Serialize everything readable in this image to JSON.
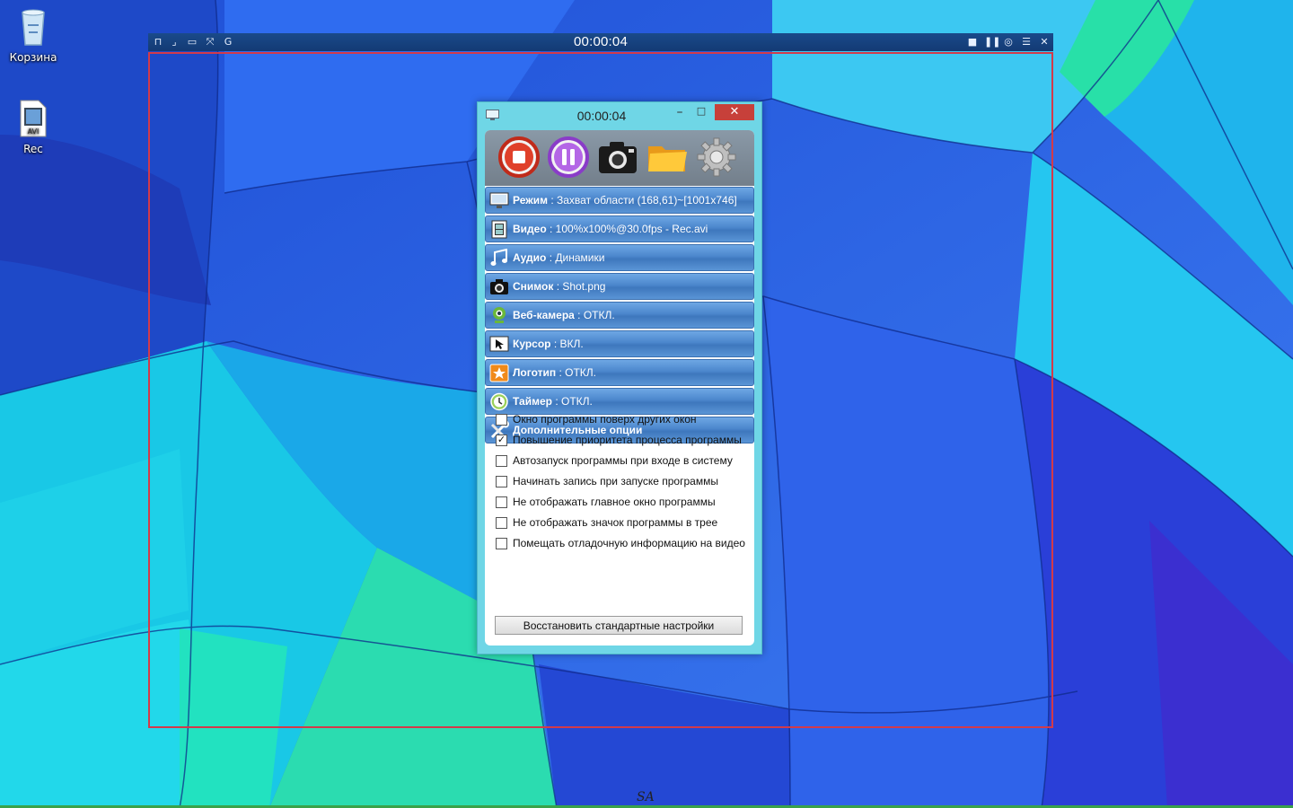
{
  "desktop": {
    "icons": [
      {
        "label": "Корзина",
        "icon": "recycle-bin-icon"
      },
      {
        "label": "Rec",
        "icon": "avi-file-icon",
        "badge": "AVI"
      }
    ],
    "watermark": "SA"
  },
  "capture_bar": {
    "time": "00:00:04",
    "left_icons": [
      "lock-icon",
      "corner-icon",
      "window-icon",
      "fullscreen-icon",
      "g-icon"
    ],
    "right_icons": [
      "stop-icon",
      "pause-icon",
      "camera-icon",
      "menu-icon",
      "close-icon"
    ]
  },
  "window": {
    "title_time": "00:00:04",
    "minimize": "–",
    "maximize": "□",
    "close": "✕",
    "toolbar": [
      "stop-button",
      "pause-button",
      "screenshot-button",
      "folder-button",
      "settings-button"
    ],
    "rows": [
      {
        "label": "Режим",
        "value": ": Захват области (168,61)~[1001x746]",
        "icon": "monitor-icon"
      },
      {
        "label": "Видео",
        "value": ": 100%x100%@30.0fps - Rec.avi",
        "icon": "film-icon"
      },
      {
        "label": "Аудио",
        "value": ": Динамики",
        "icon": "music-icon"
      },
      {
        "label": "Снимок",
        "value": ": Shot.png",
        "icon": "camera-icon"
      },
      {
        "label": "Веб-камера",
        "value": ": ОТКЛ.",
        "icon": "webcam-icon"
      },
      {
        "label": "Курсор",
        "value": ": ВКЛ.",
        "icon": "cursor-icon"
      },
      {
        "label": "Логотип",
        "value": ": ОТКЛ.",
        "icon": "star-icon"
      },
      {
        "label": "Таймер",
        "value": ": ОТКЛ.",
        "icon": "clock-icon"
      },
      {
        "label": "Дополнительные опции",
        "value": "",
        "icon": "tools-icon"
      }
    ],
    "options": [
      {
        "label": "Окно программы поверх других окон",
        "checked": false
      },
      {
        "label": "Повышение приоритета процесса программы",
        "checked": true
      },
      {
        "label": "Автозапуск программы при входе в систему",
        "checked": false
      },
      {
        "label": "Начинать запись при запуске программы",
        "checked": false
      },
      {
        "label": "Не отображать главное окно программы",
        "checked": false
      },
      {
        "label": "Не отображать значок программы в трее",
        "checked": false
      },
      {
        "label": "Помещать отладочную информацию на видео",
        "checked": false
      }
    ],
    "reset_button": "Восстановить стандартные настройки"
  },
  "colors": {
    "capture_frame": "#d23a4a",
    "window_bg": "#6fd6e6",
    "row_bg": "#4b86cc",
    "close_button": "#c7403a"
  }
}
